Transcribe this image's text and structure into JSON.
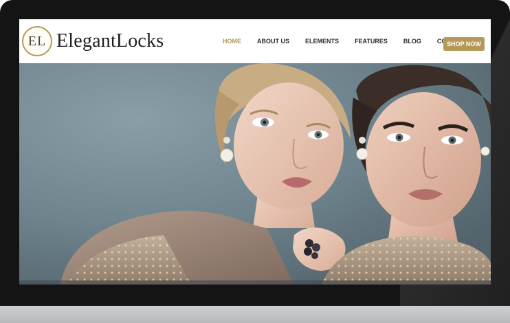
{
  "brand": {
    "logo_monogram": "EL",
    "name": "ElegantLocks"
  },
  "nav": {
    "items": [
      {
        "label": "HOME",
        "active": true
      },
      {
        "label": "ABOUT US",
        "active": false
      },
      {
        "label": "ELEMENTS",
        "active": false
      },
      {
        "label": "FEATURES",
        "active": false
      },
      {
        "label": "BLOG",
        "active": false
      },
      {
        "label": "CONTACT",
        "active": false
      }
    ],
    "cta_label": "SHOP NOW"
  },
  "colors": {
    "accent": "#b39a58",
    "nav_text": "#2a2a2a",
    "bezel": "#141414",
    "hero_background": "#6f8590"
  },
  "hero": {
    "image_description_icon": "fashion-photo-two-models"
  }
}
